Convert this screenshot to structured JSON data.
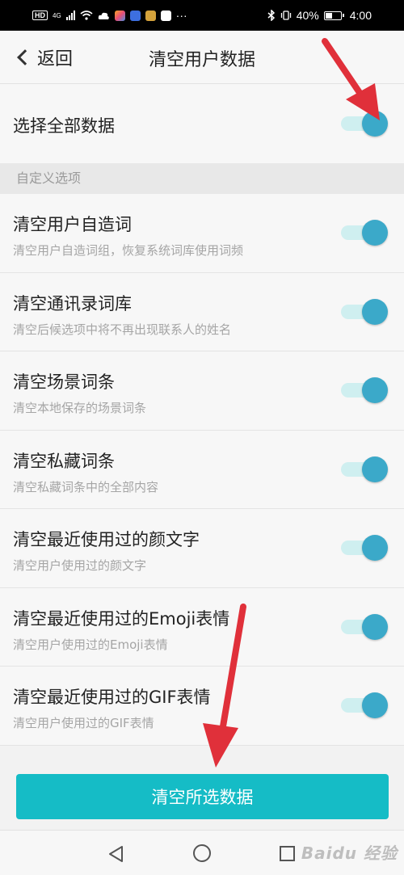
{
  "status_bar": {
    "hd_badge": "HD",
    "network": "4G",
    "more": "···",
    "battery_percent": "40%",
    "time": "4:00"
  },
  "header": {
    "back_label": "返回",
    "title": "清空用户数据"
  },
  "select_all": {
    "label": "选择全部数据",
    "enabled": true
  },
  "section": {
    "title": "自定义选项"
  },
  "options": [
    {
      "title": "清空用户自造词",
      "subtitle": "清空用户自造词组，恢复系统词库使用词频",
      "enabled": true
    },
    {
      "title": "清空通讯录词库",
      "subtitle": "清空后候选项中将不再出现联系人的姓名",
      "enabled": true
    },
    {
      "title": "清空场景词条",
      "subtitle": "清空本地保存的场景词条",
      "enabled": true
    },
    {
      "title": "清空私藏词条",
      "subtitle": "清空私藏词条中的全部内容",
      "enabled": true
    },
    {
      "title": "清空最近使用过的颜文字",
      "subtitle": "清空用户使用过的颜文字",
      "enabled": true
    },
    {
      "title": "清空最近使用过的Emoji表情",
      "subtitle": "清空用户使用过的Emoji表情",
      "enabled": true
    },
    {
      "title": "清空最近使用过的GIF表情",
      "subtitle": "清空用户使用过的GIF表情",
      "enabled": true
    }
  ],
  "footer": {
    "clear_button": "清空所选数据"
  },
  "watermark": "Baidu 经验",
  "colors": {
    "accent": "#15bcc6",
    "toggle_knob": "#3ba9c9",
    "toggle_track": "#cfeff0",
    "annotation_arrow": "#e0303a"
  }
}
